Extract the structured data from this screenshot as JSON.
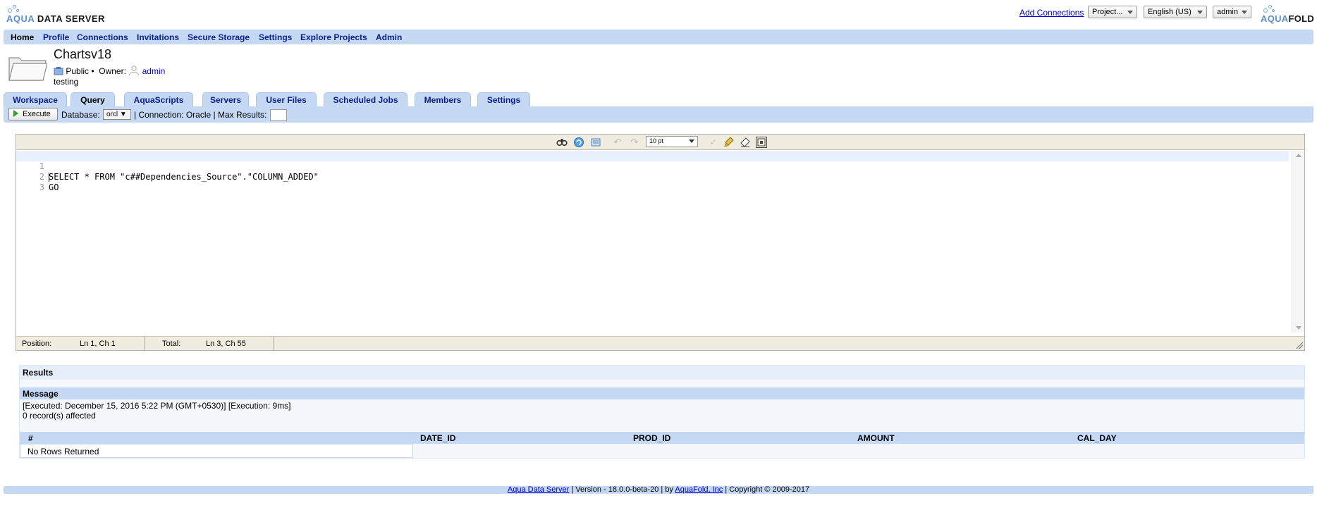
{
  "header": {
    "brand_left": {
      "aqua": "AQUA",
      "rest": " DATA SERVER"
    },
    "brand_right": {
      "aqua": "AQUA",
      "rest": "FOLD"
    },
    "add_connections": "Add Connections",
    "project_dropdown": "Project...",
    "language_dropdown": "English (US)",
    "user_dropdown": "admin"
  },
  "main_nav": {
    "items": [
      "Home",
      "Profile",
      "Connections",
      "Invitations",
      "Secure Storage",
      "Settings",
      "Explore Projects",
      "Admin"
    ]
  },
  "project": {
    "title": "Chartsv18",
    "visibility": "Public •",
    "owner_label": "Owner:",
    "owner": "admin",
    "description": "testing"
  },
  "tabs": [
    "Workspace",
    "Query",
    "AquaScripts",
    "Servers",
    "User Files",
    "Scheduled Jobs",
    "Members",
    "Settings"
  ],
  "active_tab": "Query",
  "query_toolbar": {
    "execute_label": "Execute",
    "database_label": "Database:",
    "database_value": "orcl",
    "connection_text": "| Connection: Oracle | Max Results:",
    "max_results_value": ""
  },
  "editor": {
    "toolbar_icons": [
      "find-icon",
      "refresh-icon",
      "format-icon",
      "undo-icon",
      "redo-icon",
      "spell-check-icon",
      "clean-icon",
      "eraser-icon",
      "fullscreen-icon"
    ],
    "font_size": "10 pt",
    "lines": [
      {
        "num": "1",
        "text": "SELECT * FROM \"c##Dependencies_Source\".\"COLUMN_ADDED\""
      },
      {
        "num": "2",
        "text": "GO"
      },
      {
        "num": "3",
        "text": ""
      }
    ],
    "status": {
      "position_label": "Position:",
      "position_value": "Ln 1, Ch 1",
      "total_label": "Total:",
      "total_value": "Ln 3, Ch 55"
    }
  },
  "results": {
    "title": "Results",
    "message_header": "Message",
    "message_lines": [
      "[Executed: December 15, 2016 5:22 PM (GMT+0530)] [Execution: 9ms]",
      "0 record(s) affected"
    ],
    "columns": [
      "#",
      "DATE_ID",
      "PROD_ID",
      "AMOUNT",
      "CAL_DAY"
    ],
    "empty_text": "No Rows Returned"
  },
  "footer": {
    "product_link": "Aqua Data Server",
    "version_text": " | Version - 18.0.0-beta-20 | by ",
    "company_link": "AquaFold, Inc",
    "copyright_text": " | Copyright © 2009-2017"
  },
  "colors": {
    "nav_bar": "#c5d9f5",
    "link": "#0000cc",
    "nav_text": "#0a1e8c",
    "brand_blue": "#5b8fca",
    "editor_toolbar": "#f0ede0",
    "current_line": "#e8f2fe"
  }
}
